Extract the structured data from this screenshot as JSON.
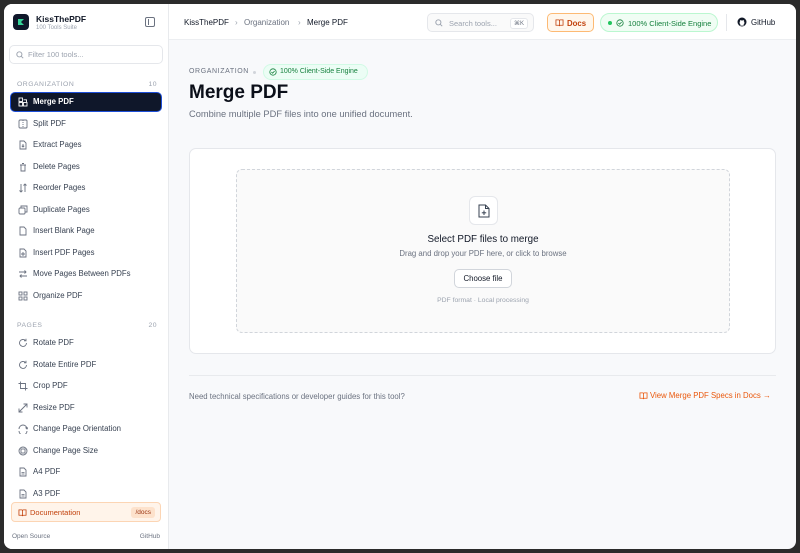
{
  "brand": {
    "name": "KissThePDF",
    "subtitle": "100 Tools Suite"
  },
  "sidebar": {
    "filter_placeholder": "Filter 100 tools...",
    "sections": [
      {
        "title": "ORGANIZATION",
        "count": "10",
        "items": [
          {
            "label": "Merge PDF",
            "icon": "merge-icon",
            "active": true
          },
          {
            "label": "Split PDF",
            "icon": "split-icon"
          },
          {
            "label": "Extract Pages",
            "icon": "extract-icon"
          },
          {
            "label": "Delete Pages",
            "icon": "trash-icon"
          },
          {
            "label": "Reorder Pages",
            "icon": "reorder-icon"
          },
          {
            "label": "Duplicate Pages",
            "icon": "duplicate-icon"
          },
          {
            "label": "Insert Blank Page",
            "icon": "blank-page-icon"
          },
          {
            "label": "Insert PDF Pages",
            "icon": "insert-pdf-icon"
          },
          {
            "label": "Move Pages Between PDFs",
            "icon": "move-icon"
          },
          {
            "label": "Organize PDF",
            "icon": "grid-icon"
          }
        ]
      },
      {
        "title": "PAGES",
        "count": "20",
        "items": [
          {
            "label": "Rotate PDF",
            "icon": "rotate-icon"
          },
          {
            "label": "Rotate Entire PDF",
            "icon": "rotate-icon"
          },
          {
            "label": "Crop PDF",
            "icon": "crop-icon"
          },
          {
            "label": "Resize PDF",
            "icon": "resize-icon"
          },
          {
            "label": "Change Page Orientation",
            "icon": "orientation-icon"
          },
          {
            "label": "Change Page Size",
            "icon": "page-size-icon"
          },
          {
            "label": "A4 PDF",
            "icon": "file-icon"
          },
          {
            "label": "A3 PDF",
            "icon": "file-icon"
          }
        ]
      }
    ],
    "docs": {
      "label": "Documentation",
      "tag": "/docs"
    },
    "footer": {
      "left": "Open Source",
      "right": "GitHub"
    }
  },
  "topbar": {
    "breadcrumbs": [
      "KissThePDF",
      "Organization",
      "Merge PDF"
    ],
    "search_placeholder": "Search tools...",
    "search_shortcut": "⌘K",
    "docs_label": "Docs",
    "engine_label": "100% Client-Side Engine",
    "github_label": "GitHub"
  },
  "main": {
    "category": "ORGANIZATION",
    "engine_label": "100% Client-Side Engine",
    "title": "Merge PDF",
    "subtitle": "Combine multiple PDF files into one unified document.",
    "dropzone": {
      "title": "Select PDF files to merge",
      "subtitle": "Drag and drop your PDF here, or click to browse",
      "button": "Choose file",
      "meta": "PDF format · Local processing"
    },
    "footer_question": "Need technical specifications or developer guides for this tool?",
    "footer_link": "View Merge PDF Specs in Docs →"
  },
  "colors": {
    "accent": "#ea580c",
    "active_bg": "#0f172a",
    "success": "#15803d"
  }
}
